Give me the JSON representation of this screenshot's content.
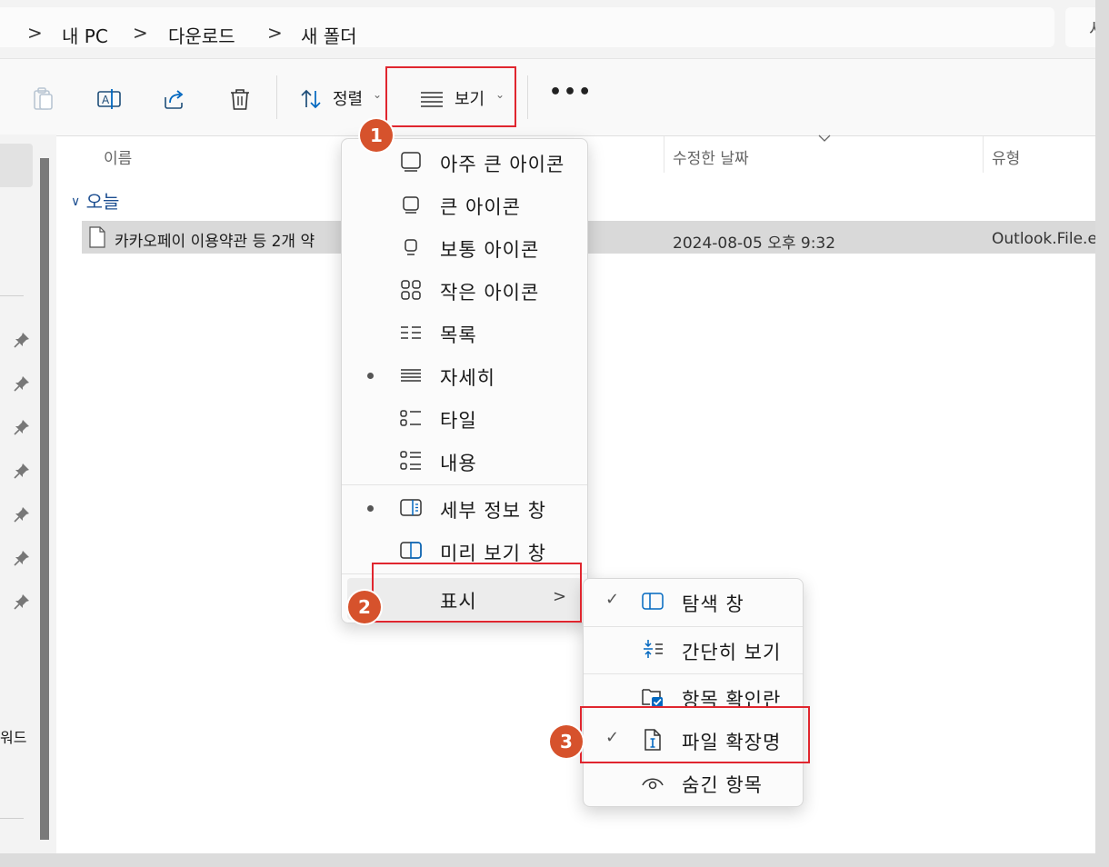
{
  "breadcrumb": {
    "items": [
      "내 PC",
      "다운로드",
      "새 폴더"
    ],
    "sep": ">",
    "right_partial": "새"
  },
  "toolbar": {
    "sort_label": "정렬",
    "view_label": "보기",
    "more_label": "•••"
  },
  "columns": {
    "name": "이름",
    "date": "수정한 날짜",
    "type": "유형"
  },
  "group_label": "오늘",
  "file": {
    "name": "카카오페이 이용약관 등 2개 약",
    "date": "2024-08-05 오후 9:32",
    "type": "Outlook.File.eml"
  },
  "nav": {
    "partial_text": "워드"
  },
  "view_menu": {
    "items": [
      {
        "label": "아주 큰 아이콘",
        "icon": "extra-large-icons-icon",
        "selected": false
      },
      {
        "label": "큰 아이콘",
        "icon": "large-icons-icon",
        "selected": false
      },
      {
        "label": "보통 아이콘",
        "icon": "medium-icons-icon",
        "selected": false
      },
      {
        "label": "작은 아이콘",
        "icon": "small-icons-icon",
        "selected": false
      },
      {
        "label": "목록",
        "icon": "list-icon",
        "selected": false
      },
      {
        "label": "자세히",
        "icon": "details-icon",
        "selected": true
      },
      {
        "label": "타일",
        "icon": "tiles-icon",
        "selected": false
      },
      {
        "label": "내용",
        "icon": "content-icon",
        "selected": false
      }
    ],
    "panes": [
      {
        "label": "세부 정보 창",
        "icon": "details-pane-icon",
        "selected": true
      },
      {
        "label": "미리 보기 창",
        "icon": "preview-pane-icon",
        "selected": false
      }
    ],
    "show_label": "표시",
    "show_arrow": ">"
  },
  "show_menu": {
    "items": [
      {
        "label": "탐색 창",
        "icon": "navigation-pane-icon",
        "checked": true
      },
      {
        "label": "간단히 보기",
        "icon": "compact-view-icon",
        "checked": false
      },
      {
        "label": "항목 확인란",
        "icon": "item-checkboxes-icon",
        "checked": false
      },
      {
        "label": "파일 확장명",
        "icon": "file-extensions-icon",
        "checked": true
      },
      {
        "label": "숨긴 항목",
        "icon": "hidden-items-icon",
        "checked": false
      }
    ],
    "check_mark": "✓"
  },
  "badges": [
    "1",
    "2",
    "3"
  ],
  "colors": {
    "highlight": "#e0262f",
    "badge": "#d6522c",
    "accent": "#0067c0"
  }
}
